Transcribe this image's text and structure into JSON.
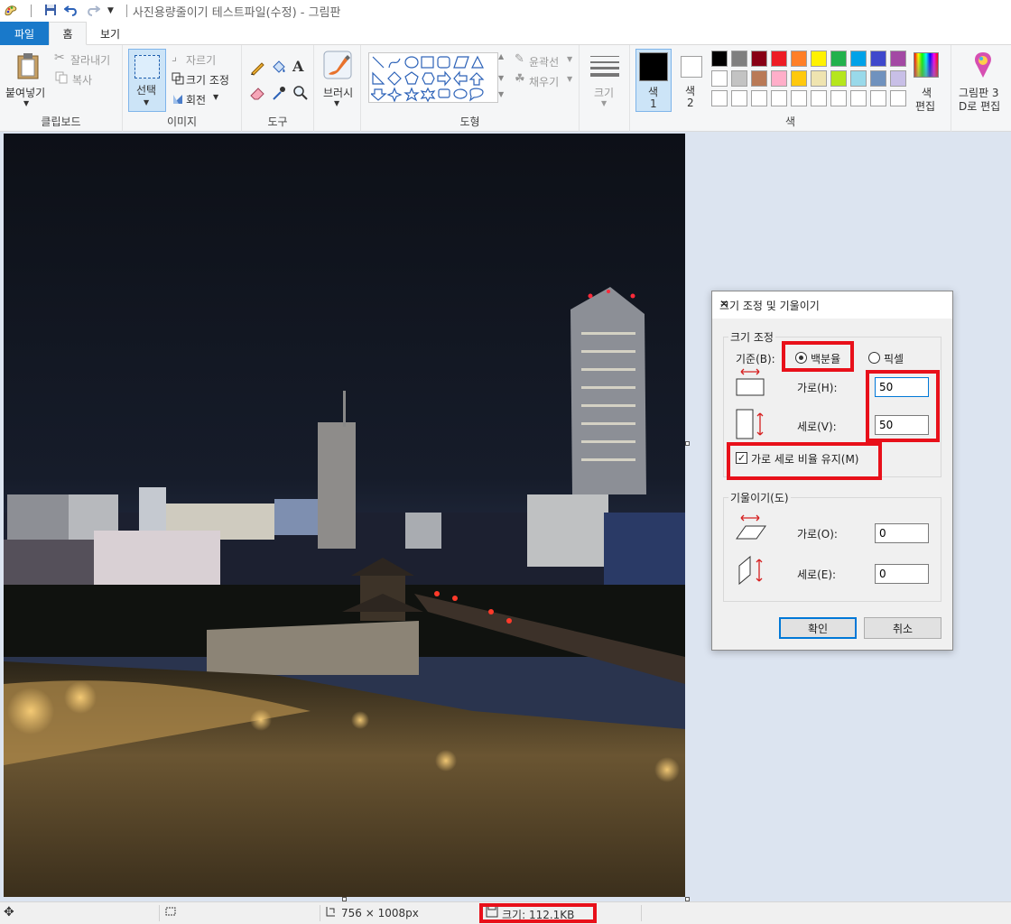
{
  "window": {
    "title": "사진용량줄이기 테스트파일(수정) - 그림판"
  },
  "tabs": [
    {
      "label": "파일"
    },
    {
      "label": "홈"
    },
    {
      "label": "보기"
    }
  ],
  "ribbon": {
    "clipboard": {
      "paste": "붙여넣기",
      "cut": "잘라내기",
      "copy": "복사",
      "group": "클립보드"
    },
    "image": {
      "select": "선택",
      "crop": "자르기",
      "resize": "크기 조정",
      "rotate": "회전",
      "group": "이미지"
    },
    "tools": {
      "group": "도구"
    },
    "brush": {
      "label": "브러시"
    },
    "shapes": {
      "outline": "윤곽선",
      "fill": "채우기",
      "group": "도형"
    },
    "size": {
      "label": "크기"
    },
    "colors": {
      "color1": "색\n1",
      "color1_line1": "색",
      "color1_line2": "1",
      "color2_line1": "색",
      "color2_line2": "2",
      "edit_line1": "색",
      "edit_line2": "편집",
      "group": "색",
      "palette_row1": [
        "#000000",
        "#7f7f7f",
        "#880015",
        "#ed1c24",
        "#ff7f27",
        "#fff200",
        "#22b14c",
        "#00a2e8",
        "#3f48cc",
        "#a349a4"
      ],
      "palette_row2": [
        "#ffffff",
        "#c3c3c3",
        "#b97a57",
        "#ffaec9",
        "#ffc90e",
        "#efe4b0",
        "#b5e61d",
        "#99d9ea",
        "#7092be",
        "#c8bfe7"
      ],
      "color1_value": "#000000",
      "color2_value": "#ffffff"
    },
    "paint3d": {
      "line1": "그림판 3",
      "line2": "D로 편집"
    }
  },
  "statusbar": {
    "dimensions": "756 × 1008px",
    "size": "크기: 112.1KB"
  },
  "dialog": {
    "title": "크기 조정 및 기울이기",
    "resize_section": "크기 조정",
    "basis_label": "기준(B):",
    "percent_label": "백분율",
    "pixel_label": "픽셀",
    "horizontal_label": "가로(H):",
    "vertical_label": "세로(V):",
    "horizontal_value": "50",
    "vertical_value": "50",
    "keep_ratio_label": "가로 세로 비율 유지(M)",
    "skew_section": "기울이기(도)",
    "skew_h_label": "가로(O):",
    "skew_v_label": "세로(E):",
    "skew_h_value": "0",
    "skew_v_value": "0",
    "ok": "확인",
    "cancel": "취소"
  },
  "highlight_color": "#e8101a"
}
